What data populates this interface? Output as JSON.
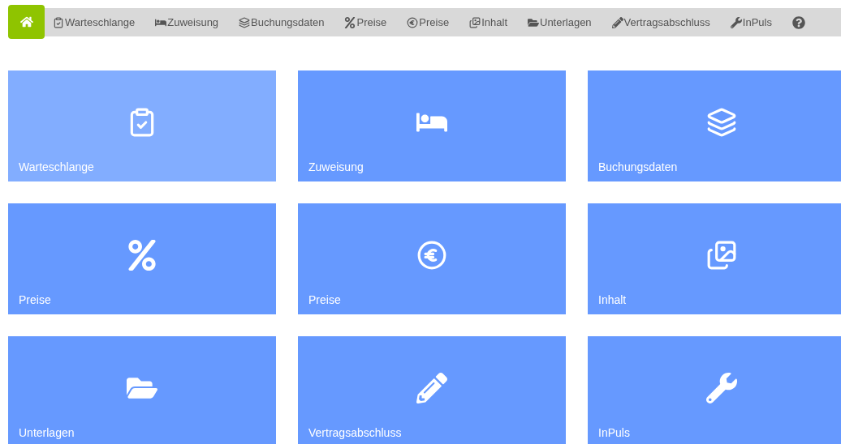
{
  "nav": {
    "home": {
      "kind": "home"
    },
    "items": [
      {
        "label": "Warteschlange",
        "kind": "clipboard"
      },
      {
        "label": "Zuweisung",
        "kind": "bed"
      },
      {
        "label": "Buchungsdaten",
        "kind": "layers"
      },
      {
        "label": "Preise",
        "kind": "percent"
      },
      {
        "label": "Preise",
        "kind": "euro"
      },
      {
        "label": "Inhalt",
        "kind": "images"
      },
      {
        "label": "Unterlagen",
        "kind": "folder"
      },
      {
        "label": "Vertragsabschluss",
        "kind": "pencil"
      },
      {
        "label": "InPuls",
        "kind": "wrench"
      }
    ],
    "help": {
      "kind": "help"
    }
  },
  "tiles": [
    {
      "label": "Warteschlange",
      "kind": "clipboard",
      "highlighted": true
    },
    {
      "label": "Zuweisung",
      "kind": "bed",
      "highlighted": false
    },
    {
      "label": "Buchungsdaten",
      "kind": "layers",
      "highlighted": false
    },
    {
      "label": "Preise",
      "kind": "percent",
      "highlighted": false
    },
    {
      "label": "Preise",
      "kind": "euro",
      "highlighted": false
    },
    {
      "label": "Inhalt",
      "kind": "images",
      "highlighted": false
    },
    {
      "label": "Unterlagen",
      "kind": "folder",
      "highlighted": false
    },
    {
      "label": "Vertragsabschluss",
      "kind": "pencil",
      "highlighted": false
    },
    {
      "label": "InPuls",
      "kind": "wrench",
      "highlighted": false
    }
  ]
}
